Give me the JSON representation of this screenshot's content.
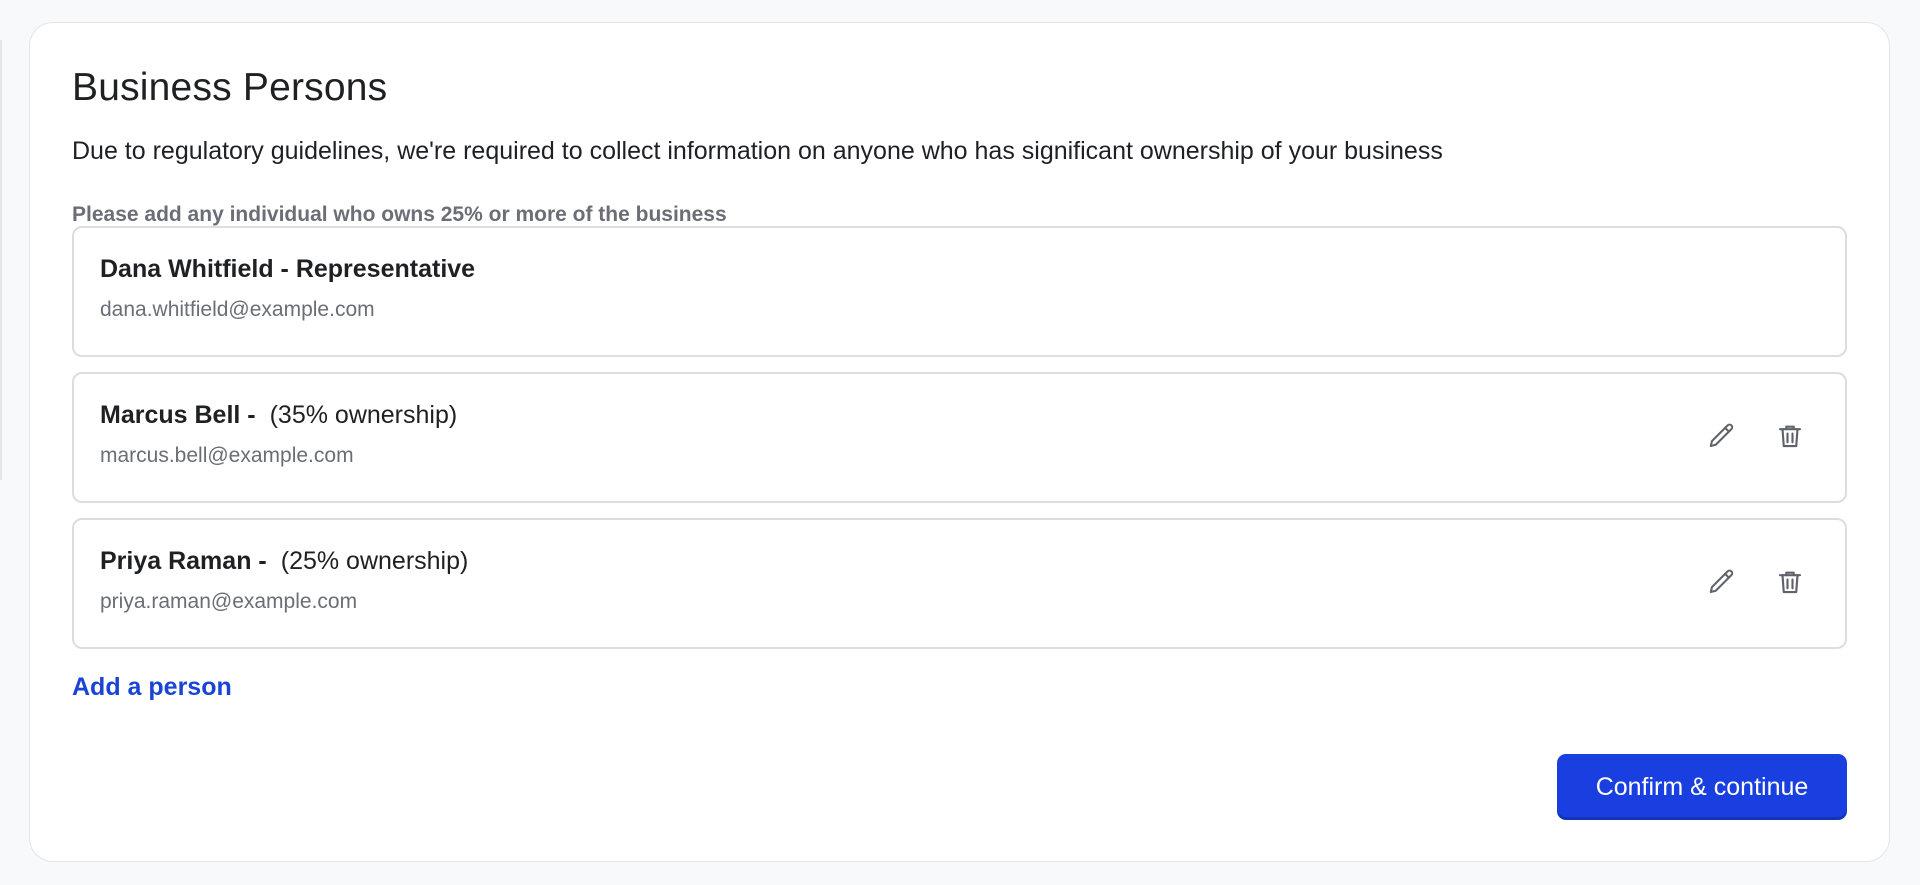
{
  "page": {
    "title": "Business Persons",
    "subtitle": "Due to regulatory guidelines, we're required to collect information on anyone who has significant ownership of your business",
    "hint": "Please add any individual who owns 25% or more of the business"
  },
  "persons": [
    {
      "name": "Dana Whitfield - Representative",
      "ownership": "",
      "email": "dana.whitfield@example.com",
      "editable": false
    },
    {
      "name": "Marcus Bell -",
      "ownership": "(35% ownership)",
      "email": "marcus.bell@example.com",
      "editable": true
    },
    {
      "name": "Priya Raman -",
      "ownership": "(25% ownership)",
      "email": "priya.raman@example.com",
      "editable": true
    }
  ],
  "actions": {
    "add_person_label": "Add a person",
    "confirm_label": "Confirm & continue"
  },
  "icons": {
    "edit": "pencil-icon",
    "delete": "trash-icon"
  },
  "colors": {
    "accent": "#1a3fe0",
    "link": "#1a44d6",
    "muted_text": "#6b6e76",
    "border": "#dcdde1"
  }
}
